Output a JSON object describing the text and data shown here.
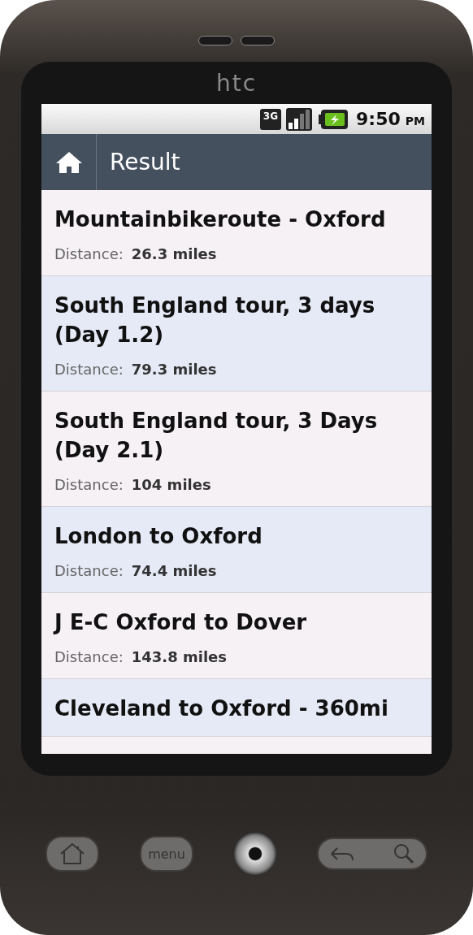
{
  "device": {
    "brand": "htc",
    "menu_key": "menu"
  },
  "status_bar": {
    "network": "3G",
    "time": "9:50",
    "period": "PM"
  },
  "header": {
    "title": "Result"
  },
  "routes": [
    {
      "title": "Mountainbikeroute - Oxford",
      "distance_label": "Distance:",
      "distance": "26.3 miles"
    },
    {
      "title": "South England tour, 3 days (Day 1.2)",
      "distance_label": "Distance:",
      "distance": "79.3 miles"
    },
    {
      "title": "South England tour, 3 Days (Day 2.1)",
      "distance_label": "Distance:",
      "distance": "104 miles"
    },
    {
      "title": "London to Oxford",
      "distance_label": "Distance:",
      "distance": "74.4 miles"
    },
    {
      "title": "J E-C Oxford to Dover",
      "distance_label": "Distance:",
      "distance": "143.8 miles"
    },
    {
      "title": "Cleveland to Oxford - 360mi"
    }
  ]
}
